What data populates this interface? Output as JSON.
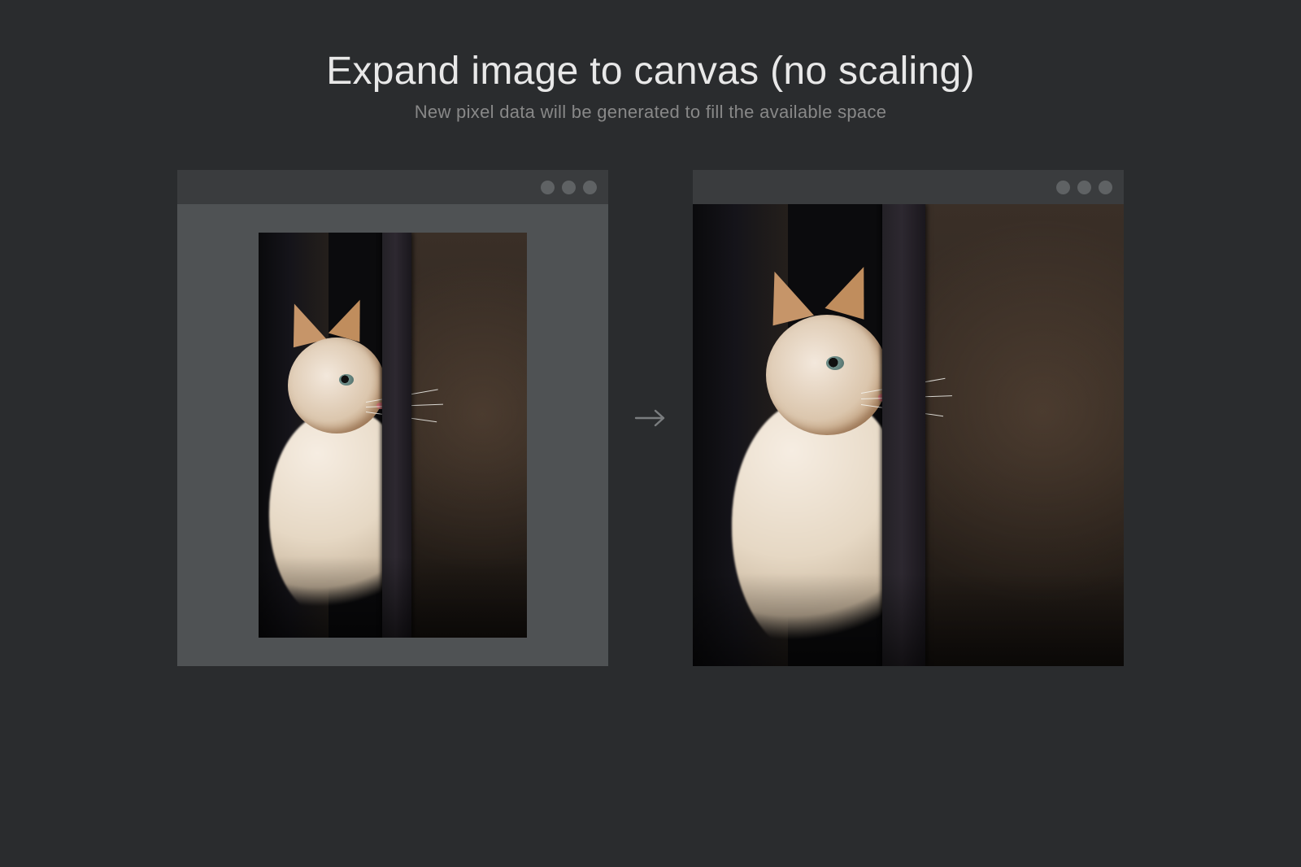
{
  "header": {
    "title": "Expand image to canvas (no scaling)",
    "subtitle": "New pixel data will be generated to fill the available space"
  },
  "arrow": {
    "glyph": "→"
  }
}
